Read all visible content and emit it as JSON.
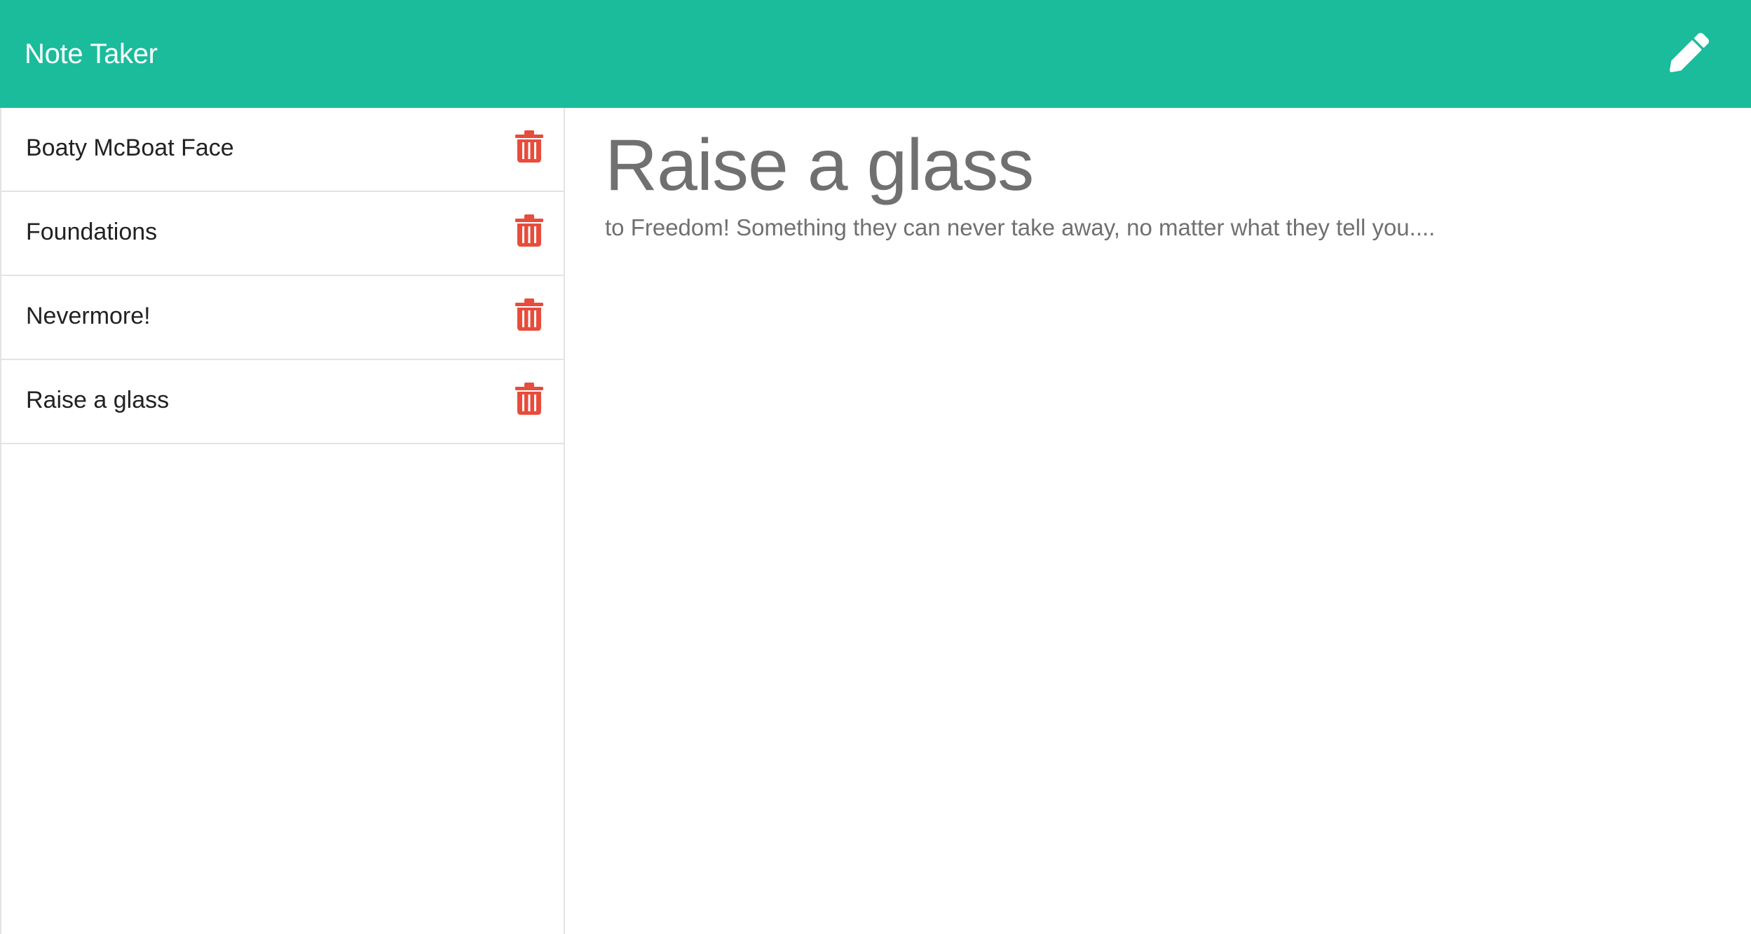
{
  "app": {
    "title": "Note Taker"
  },
  "header": {
    "new_note_icon": "pencil-icon"
  },
  "sidebar": {
    "notes": [
      {
        "title": "Boaty McBoat Face",
        "delete_icon": "trash-icon"
      },
      {
        "title": "Foundations",
        "delete_icon": "trash-icon"
      },
      {
        "title": "Nevermore!",
        "delete_icon": "trash-icon"
      },
      {
        "title": "Raise a glass",
        "delete_icon": "trash-icon"
      }
    ]
  },
  "active_note": {
    "title": "Raise a glass",
    "text": "to Freedom! Something they can never take away, no matter what they tell you...."
  },
  "colors": {
    "accent": "#1abc9c",
    "delete": "#e74c3c",
    "text_muted": "#707070"
  }
}
